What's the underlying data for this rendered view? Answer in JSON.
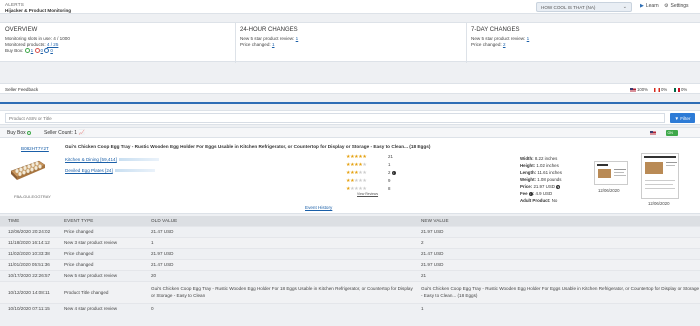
{
  "header": {
    "section": "ALERTS",
    "title": "Hijacker & Product Monitoring",
    "account": "HOW COOL IS THAT (NA)",
    "learn": "Learn",
    "settings": "Settings"
  },
  "overview": {
    "title": "OVERVIEW",
    "slots_label": "Monitoring slots in use:",
    "slots_value": "4 / 1000",
    "monitored_label": "Monitored products:",
    "monitored_value": "4 / 25",
    "buybox_label": "Buy Box:",
    "buybox_counts": [
      "1",
      "0",
      "0"
    ],
    "buybox_colors": [
      "#3ea84a",
      "#d9534f",
      "#2d6db3"
    ]
  },
  "changes_24h": {
    "title": "24-HOUR CHANGES",
    "line1_label": "New 5 star product review:",
    "line1_value": "1",
    "line2_label": "Price changed:",
    "line2_value": "1"
  },
  "changes_7d": {
    "title": "7-DAY CHANGES",
    "line1_label": "New 5 star product review:",
    "line1_value": "1",
    "line2_label": "Price changed:",
    "line2_value": "2"
  },
  "feedback": {
    "label": "Seller Feedback",
    "us": "100%",
    "ca": "0%",
    "mx": "0%"
  },
  "filter": {
    "placeholder": "Product ASIN or Title",
    "button": "Filter"
  },
  "seller": {
    "buybox_label": "Buy Box",
    "count_label": "Seller Count:",
    "count_value": "1",
    "toggle": "ON"
  },
  "product": {
    "asin": "B082HT7Y2T",
    "sku": "FBA-GUI-EGGTRAY",
    "title": "Gui's Chicken Coop Egg Tray - Rustic Wooden Egg Holder For Eggs Usable in Kitchen Refrigerator, or Countertop for Display or Storage - Easy to Clean... (18 Eggs)",
    "category1": "Kitchen & Dining [59,414]",
    "category2": "Deviled Egg Plates [24]",
    "ratings": [
      {
        "stars": 5,
        "count": "21"
      },
      {
        "stars": 4,
        "count": "1"
      },
      {
        "stars": 3,
        "count": "2"
      },
      {
        "stars": 2,
        "count": "9"
      },
      {
        "stars": 1,
        "count": "8"
      }
    ],
    "view_reviews": "View Reviews",
    "event_history": "Event History",
    "details": {
      "width": "8.22 inches",
      "height": "1.02 inches",
      "length": "11.61 inches",
      "weight": "1.08 pounds",
      "price": "21.97 USD",
      "fee": "4.9 USD",
      "adult": "No"
    },
    "thumb_dates": [
      "12/06/2020",
      "12/06/2020"
    ]
  },
  "events": {
    "headers": [
      "TIME",
      "EVENT TYPE",
      "OLD VALUE",
      "NEW VALUE"
    ],
    "rows": [
      {
        "time": "12/06/2020 20:24:02",
        "type": "Price changed",
        "old": "21.47 USD",
        "new": "21.97 USD"
      },
      {
        "time": "11/18/2020 16:14:12",
        "type": "New 3 star product review",
        "old": "1",
        "new": "2"
      },
      {
        "time": "11/02/2020 10:33:38",
        "type": "Price changed",
        "old": "21.97 USD",
        "new": "21.47 USD"
      },
      {
        "time": "11/01/2020 05:51:36",
        "type": "Price changed",
        "old": "21.47 USD",
        "new": "21.97 USD"
      },
      {
        "time": "10/17/2020 22:26:57",
        "type": "New 5 star product review",
        "old": "20",
        "new": "21"
      },
      {
        "time": "10/12/2020 14:08:11",
        "type": "Product Title changed",
        "old": "Gui's Chicken Coop Egg Tray - Rustic Wooden Egg Holder For 18 Eggs Usable in Kitchen Refrigerator, or Countertop for Display or Storage - Easy to Clean",
        "new": "Gui's Chicken Coop Egg Tray - Rustic Wooden Egg Holder For Eggs Usable in Kitchen Refrigerator, or Countertop for Display or Storage - Easy to Clean... (18 Eggs)"
      },
      {
        "time": "10/10/2020 07:11:15",
        "type": "New 4 star product review",
        "old": "0",
        "new": "1"
      }
    ]
  }
}
